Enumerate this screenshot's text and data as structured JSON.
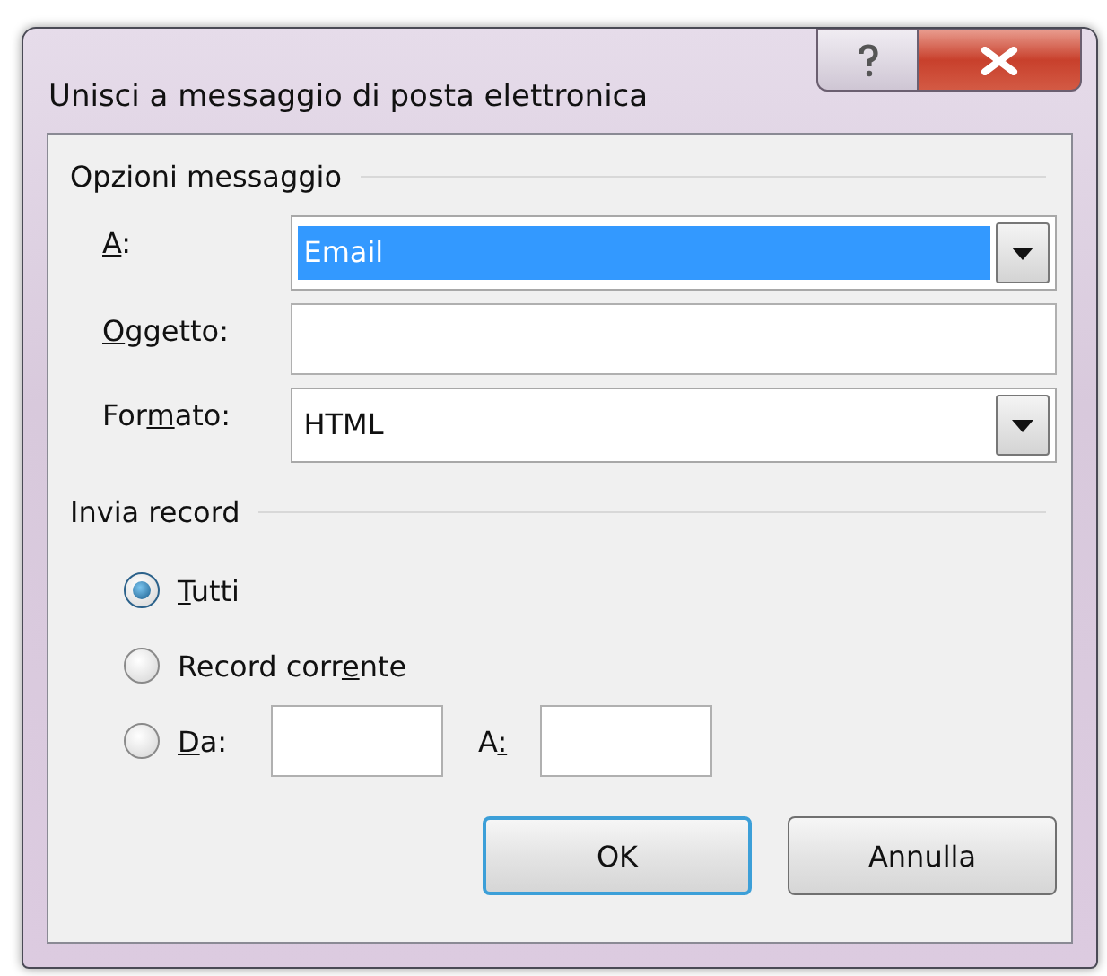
{
  "window": {
    "title": "Unisci a messaggio di posta elettronica"
  },
  "message_options": {
    "heading": "Opzioni messaggio",
    "fields": [
      {
        "kind": "combo",
        "label": {
          "key": "A",
          "post": ":"
        },
        "value": "Email",
        "selected": true
      },
      {
        "kind": "text",
        "label": {
          "key": "O",
          "post": "ggetto:"
        }
      },
      {
        "kind": "combo",
        "label": {
          "pre": "For",
          "key": "m",
          "post": "ato:"
        },
        "value": "HTML",
        "selected": false
      }
    ]
  },
  "send_records": {
    "heading": "Invia record",
    "options": [
      {
        "kind": "plain",
        "label": {
          "key": "T",
          "post": "utti"
        },
        "selected": true
      },
      {
        "kind": "plain",
        "label": {
          "pre": "Record corr",
          "key": "e",
          "post": "nte"
        },
        "selected": false
      },
      {
        "kind": "range",
        "label": {
          "key": "D",
          "post": "a:"
        },
        "to_label": {
          "pre": "A",
          "key": ":"
        },
        "selected": false
      }
    ]
  },
  "buttons": [
    {
      "label": "OK",
      "default": true
    },
    {
      "label": "Annulla",
      "default": false
    }
  ]
}
